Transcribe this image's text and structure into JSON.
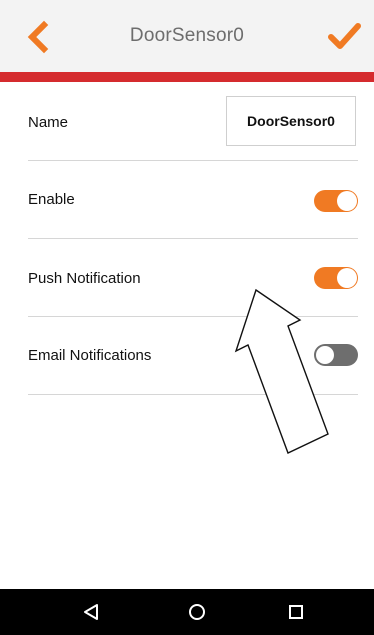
{
  "header": {
    "title": "DoorSensor0",
    "back_icon": "chevron-left-icon",
    "confirm_icon": "checkmark-icon",
    "accent_color": "#f07a23",
    "bar_color": "#d52b2e"
  },
  "settings": {
    "name": {
      "label": "Name",
      "value": "DoorSensor0"
    },
    "enable": {
      "label": "Enable",
      "state": "on"
    },
    "push_notification": {
      "label": "Push Notification",
      "state": "on"
    },
    "email_notifications": {
      "label": "Email Notifications",
      "state": "off"
    }
  },
  "annotation": {
    "icon": "outline-arrow-icon"
  },
  "navbar": {
    "buttons": [
      "back-triangle-icon",
      "home-circle-icon",
      "recents-square-icon"
    ]
  }
}
